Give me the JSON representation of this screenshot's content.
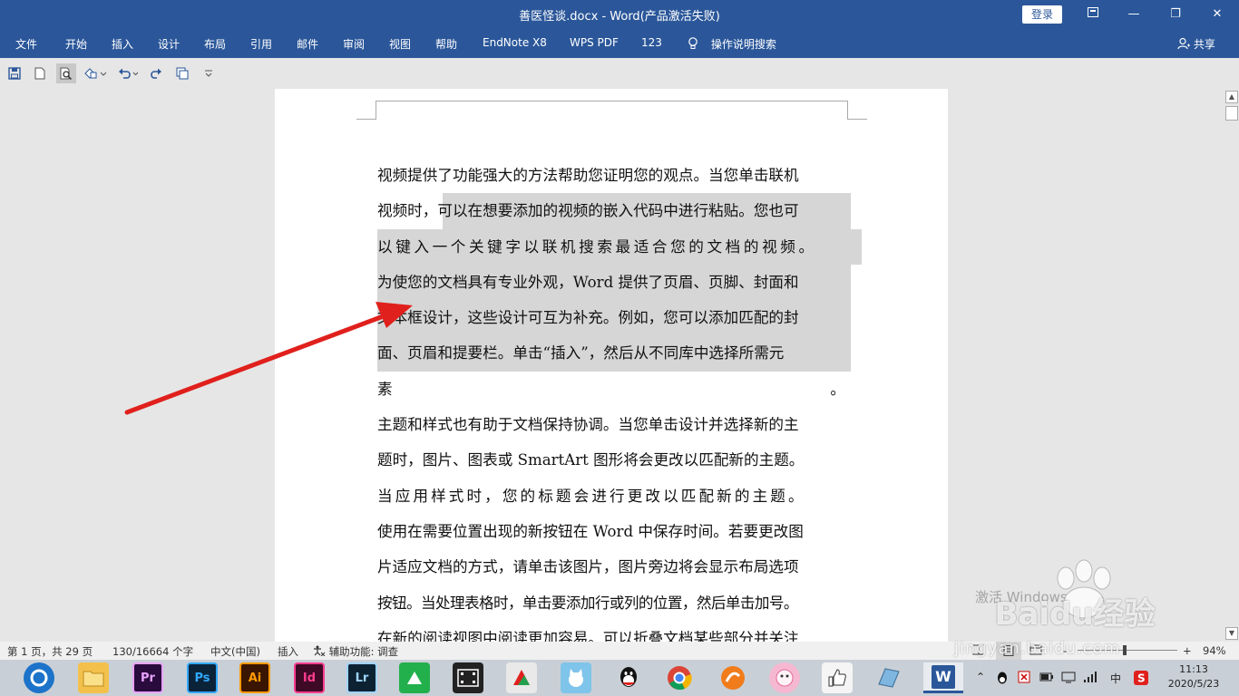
{
  "window": {
    "title": "善医怪谈.docx  -  Word(产品激活失败)",
    "login_label": "登录",
    "ribbon_display_icon": "ribbon-display-icon",
    "minimize": "—",
    "restore": "❐",
    "close": "✕"
  },
  "ribbon": {
    "tabs": [
      "文件",
      "开始",
      "插入",
      "设计",
      "布局",
      "引用",
      "邮件",
      "审阅",
      "视图",
      "帮助",
      "EndNote X8",
      "WPS PDF",
      "123"
    ],
    "tell_me": "操作说明搜索",
    "share": "共享"
  },
  "qat": {
    "icons": [
      "save-icon",
      "new-document-icon",
      "print-preview-icon",
      "shapes-icon",
      "undo-icon",
      "redo-icon",
      "multiple-pages-icon",
      "customize-icon"
    ]
  },
  "document": {
    "lines": [
      "视频提供了功能强大的方法帮助您证明您的观点。当您单击联机",
      "视频时，可以在想要添加的视频的嵌入代码中进行粘贴。您也可",
      "以键入一个关键字以联机搜索最适合您的文档的视频。",
      "为使您的文档具有专业外观，Word 提供了页眉、页脚、封面和",
      "文本框设计，这些设计可互为补充。例如，您可以添加匹配的封",
      "面、页眉和提要栏。单击“插入”，然后从不同库中选择所需元",
      "素",
      "主题和样式也有助于文档保持协调。当您单击设计并选择新的主",
      "题时，图片、图表或 SmartArt 图形将会更改以匹配新的主题。",
      "当应用样式时，您的标题会进行更改以匹配新的主题。",
      "使用在需要位置出现的新按钮在 Word 中保存时间。若要更改图",
      "片适应文档的方式，请单击该图片，图片旁边将会显示布局选项",
      "按钮。当处理表格时，单击要添加行或列的位置，然后单击加号。",
      "在新的阅读视图中阅读更加容易。可以折叠文档某些部分并关注"
    ],
    "line7_end": "。"
  },
  "status": {
    "page": "第 1 页，共 29 页",
    "words": "130/16664 个字",
    "language": "中文(中国)",
    "mode": "插入",
    "accessibility": "辅助功能: 调查",
    "zoom_minus": "-",
    "zoom_plus": "+",
    "zoom": "94%"
  },
  "taskbar": {
    "apps": [
      {
        "name": "browser",
        "label": "",
        "color": "#1c73c9"
      },
      {
        "name": "file-explorer",
        "label": "",
        "color": "#f3c14b"
      },
      {
        "name": "premiere",
        "label": "Pr",
        "color": "#2a0b3d"
      },
      {
        "name": "photoshop",
        "label": "Ps",
        "color": "#0b2339"
      },
      {
        "name": "illustrator",
        "label": "Ai",
        "color": "#3a1500"
      },
      {
        "name": "indesign",
        "label": "Id",
        "color": "#3e0a26"
      },
      {
        "name": "lightroom",
        "label": "Lr",
        "color": "#0c2233"
      },
      {
        "name": "app-green",
        "label": "",
        "color": "#22b04d"
      },
      {
        "name": "video-editor",
        "label": "",
        "color": "#222"
      },
      {
        "name": "app-red-green",
        "label": "",
        "color": "#e9e9e9"
      },
      {
        "name": "app-cat",
        "label": "",
        "color": "#7fc4ea"
      },
      {
        "name": "qq",
        "label": "",
        "color": "#c9cfd6"
      },
      {
        "name": "chrome",
        "label": "",
        "color": "#c9cfd6"
      },
      {
        "name": "app-orange",
        "label": "",
        "color": "#c9cfd6"
      },
      {
        "name": "app-pink",
        "label": "",
        "color": "#f5b8d0"
      },
      {
        "name": "app-thumb",
        "label": "",
        "color": "#f5f5f5"
      },
      {
        "name": "app-note",
        "label": "",
        "color": "#7fb6e0"
      },
      {
        "name": "word",
        "label": "W",
        "color": "#2b579a"
      }
    ],
    "tray_ime": "中",
    "time": "11:13",
    "date": "2020/5/23"
  },
  "watermark": {
    "brand": "Baidu经验",
    "url": "jingyan.baidu.com",
    "activate_text": "激活 Windows"
  }
}
